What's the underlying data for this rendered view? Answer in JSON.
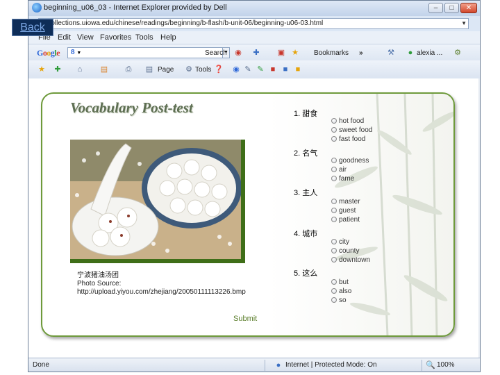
{
  "back_button": "Back",
  "window": {
    "title": "beginning_u06_03 - Internet Explorer provided by Dell"
  },
  "address": {
    "url": "://collections.uiowa.edu/chinese/readings/beginning/b-flash/b-unit-06/beginning-u06-03.html"
  },
  "menu": [
    "File",
    "Edit",
    "View",
    "Favorites",
    "Tools",
    "Help"
  ],
  "google_toolbar": {
    "logo": [
      "G",
      "o",
      "o",
      "g",
      "l",
      "e"
    ],
    "search_label": "Search",
    "bookmarks_label": "Bookmarks",
    "more": "»",
    "user": "alexia ..."
  },
  "command_bar": {
    "page_label": "Page",
    "tools_label": "Tools"
  },
  "page": {
    "title": "Vocabulary Post-test",
    "caption": [
      "宁波猪油汤团",
      "Photo Source:",
      "http://upload.yiyou.com/zhejiang/20050111113226.bmp"
    ],
    "questions": [
      {
        "label": "1. 甜食",
        "options": [
          "hot food",
          "sweet food",
          "fast food"
        ]
      },
      {
        "label": "2. 名气",
        "options": [
          "goodness",
          "air",
          "fame"
        ]
      },
      {
        "label": "3. 主人",
        "options": [
          "master",
          "guest",
          "patient"
        ]
      },
      {
        "label": "4. 城市",
        "options": [
          "city",
          "county",
          "downtown"
        ]
      },
      {
        "label": "5. 这么",
        "options": [
          "but",
          "also",
          "so"
        ]
      }
    ],
    "submit_label": "Submit"
  },
  "status": {
    "left": "Done",
    "zone": "Internet | Protected Mode: On",
    "zoom": "100%"
  }
}
